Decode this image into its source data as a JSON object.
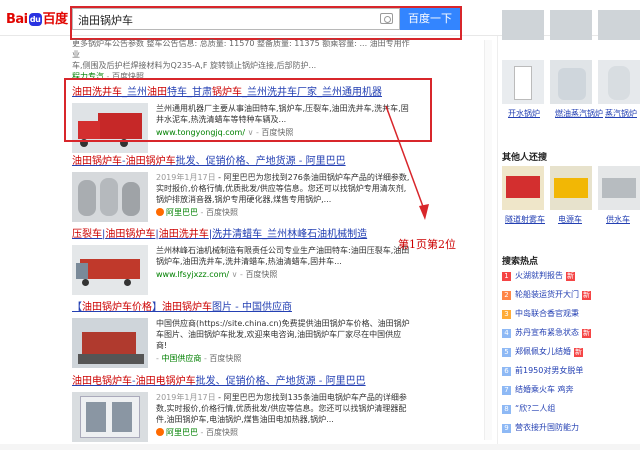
{
  "search": {
    "logo_pre": "Bai",
    "logo_mid": "du",
    "logo_post": "百度",
    "query": "油田锅炉车",
    "button": "百度一下"
  },
  "top_snippet": {
    "line1": "更多锅炉车公告参数 整车公告信息: 总质量: 11570 整备质量: 11375 额乘容量: ... 油田专用作业",
    "line2": "车,侧围及后护栏焊接材料为Q235-A,F 旋转锁止锅炉连接,后部防护...",
    "source": "程力专汽",
    "sep": " - ",
    "kuaizhao": "百度快照"
  },
  "results": [
    {
      "title_k1": "油田洗井车",
      "title_p1": "_兰州",
      "title_k2": "油田",
      "title_p2": "特车_甘肃",
      "title_k3": "锅炉车",
      "title_p3": "_兰州洗井车厂家_兰州通用机器",
      "text": "兰州通用机器厂主要从事油田特车,锅炉车,压裂车,油田洗井车,洗井车,固井水泥车,热洗清蜡车等特种车辆及",
      "text2": "...",
      "url": "www.tongyongjq.com/",
      "kuaizhao": "百度快照"
    },
    {
      "title_k1": "油田锅炉车",
      "title_p1": "-",
      "title_k2": "油田锅炉车",
      "title_p2": "批发、促销价格、产地货源 - 阿里巴巴",
      "date": "2019年1月17日",
      "text": " - 阿里巴巴为您找到276条油田锅炉车产品的详细参数,实时报价,价格行情,优质批发/供应等信息。您还可以找锅炉专用清灰剂,锅炉排放消音器,锅炉专用硬化器,煤售专用锅炉,...",
      "src": "阿里巴巴",
      "kuaizhao": "百度快照"
    },
    {
      "title_k1": "压裂车",
      "title_p1": "|",
      "title_k2": "油田锅炉车",
      "title_p2": "|",
      "title_k3": "油田洗井车",
      "title_p3": "|洗井清蜡车_兰州林峰石油机械制造",
      "text": "兰州林峰石油机械制造有限责任公司专业生产油田特车:油田压裂车,油田锅炉车,油田洗井车,洗井清蜡车,热油清蜡车,固井车...",
      "url": "www.lfsyjxzz.com/",
      "kuaizhao": "百度快照"
    },
    {
      "title_p0": "【",
      "title_k1": "油田锅炉车价格",
      "title_p1": "】",
      "title_k2": "油田锅炉车",
      "title_p2": "图片 - 中国供应商",
      "text": "中国供应商(https://site.china.cn)免费提供油田锅炉车价格、油田锅炉车图片、油田锅炉车批发,欢迎来电咨询,油田锅炉车厂家尽在中国供应商!",
      "src": "中国供应商",
      "kuaizhao": "百度快照"
    },
    {
      "title_k1": "油田电锅炉车",
      "title_p1": "-",
      "title_k2": "油田电锅炉车",
      "title_p2": "批发、促销价格、产地货源 - 阿里巴巴",
      "date": "2019年1月17日",
      "text": " - 阿里巴巴为您找到135条油田电锅炉车产品的详细参数,实时报价,价格行情,优质批发/供应等信息。您还可以找锅炉清理器配件,油田锅炉车,电油锅炉,煤售油田电加热器,锅炉...",
      "src": "阿里巴巴",
      "kuaizhao": "百度快照"
    }
  ],
  "annotation": "第1页第2位",
  "sidebar": {
    "row1": [
      "",
      "",
      "",
      ""
    ],
    "row2": [
      "开水锅炉",
      "燃油蒸汽锅炉",
      "蒸汽锅炉"
    ],
    "others_head": "其他人还搜",
    "row3": [
      "隧道射雾车",
      "电源车",
      "供水车"
    ],
    "hot_head": "搜索热点",
    "hot": [
      {
        "n": "1",
        "t": "火湖就判报告",
        "b": "新",
        "c": "#f54545"
      },
      {
        "n": "2",
        "t": "轮船装运货开大门",
        "b": "新",
        "c": "#ff8547"
      },
      {
        "n": "3",
        "t": "中岛联合香官观秉",
        "b": "",
        "c": "#ffac38"
      },
      {
        "n": "4",
        "t": "苏丹宣布紧急状态",
        "b": "新",
        "c": "#8eb9f5"
      },
      {
        "n": "5",
        "t": "郑佩佩女儿结婚",
        "b": "新",
        "c": "#8eb9f5"
      },
      {
        "n": "6",
        "t": "前1950对男女脱单",
        "b": "",
        "c": "#8eb9f5"
      },
      {
        "n": "7",
        "t": "结婚乘火车 鸡奔",
        "b": "",
        "c": "#8eb9f5"
      },
      {
        "n": "8",
        "t": "“欣?二人组",
        "b": "",
        "c": "#8eb9f5"
      },
      {
        "n": "9",
        "t": "营衣接升国防能力",
        "b": "",
        "c": "#8eb9f5"
      }
    ]
  }
}
